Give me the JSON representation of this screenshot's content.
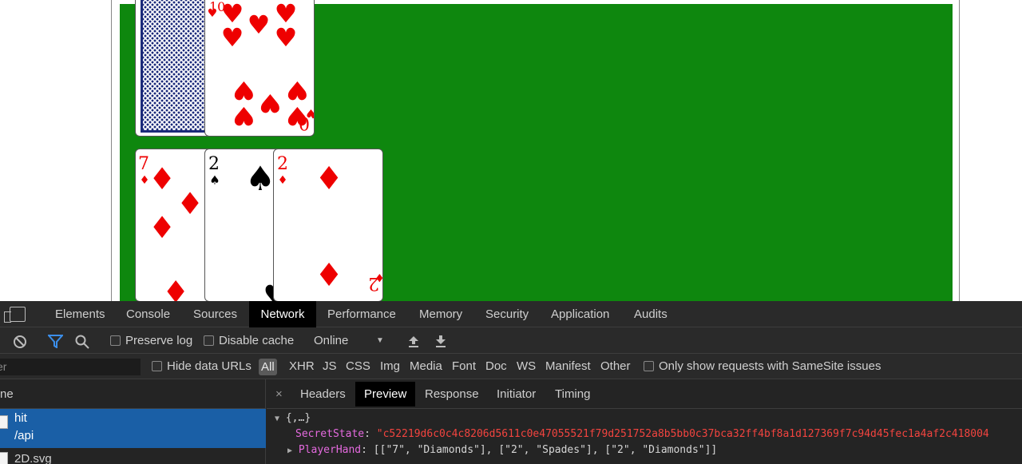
{
  "game": {
    "dealer_hand": [
      {
        "face_down": true
      },
      {
        "rank": "10",
        "suit": "Hearts",
        "rank_label": "10",
        "suit_glyph": "♥",
        "color": "red"
      }
    ],
    "player_hand": [
      {
        "rank": "7",
        "suit": "Diamonds",
        "rank_label": "7",
        "suit_glyph": "♦",
        "color": "red"
      },
      {
        "rank": "2",
        "suit": "Spades",
        "rank_label": "2",
        "suit_glyph": "♠",
        "color": "black"
      },
      {
        "rank": "2",
        "suit": "Diamonds",
        "rank_label": "2",
        "suit_glyph": "♦",
        "color": "red"
      }
    ],
    "felt_color": "#0e870e",
    "card_back_color": "#1b2a7a"
  },
  "devtools": {
    "tabs": [
      "Elements",
      "Console",
      "Sources",
      "Network",
      "Performance",
      "Memory",
      "Security",
      "Application",
      "Audits"
    ],
    "active_tab": "Network",
    "toolbar": {
      "preserve_log": "Preserve log",
      "disable_cache": "Disable cache",
      "throttling": "Online"
    },
    "filter": {
      "placeholder": "er",
      "hide_data_urls": "Hide data URLs",
      "types": [
        "All",
        "XHR",
        "JS",
        "CSS",
        "Img",
        "Media",
        "Font",
        "Doc",
        "WS",
        "Manifest",
        "Other"
      ],
      "samesite": "Only show requests with SameSite issues"
    },
    "requests": {
      "header": "ne",
      "selected": {
        "name": "hit",
        "path": "/api"
      },
      "next": "2D.svg"
    },
    "detail": {
      "close": "×",
      "tabs": [
        "Headers",
        "Preview",
        "Response",
        "Initiator",
        "Timing"
      ],
      "active_tab": "Preview",
      "preview": {
        "root": "{,…}",
        "secret_key": "SecretState",
        "secret_value": "\"c52219d6c0c4c8206d5611c0e47055521f79d251752a8b5bb0c37bca32ff4bf8a1d127369f7c94d45fec1a4af2c418004",
        "hand_key": "PlayerHand",
        "hand_value": "[[\"7\", \"Diamonds\"], [\"2\", \"Spades\"], [\"2\", \"Diamonds\"]]"
      }
    }
  }
}
